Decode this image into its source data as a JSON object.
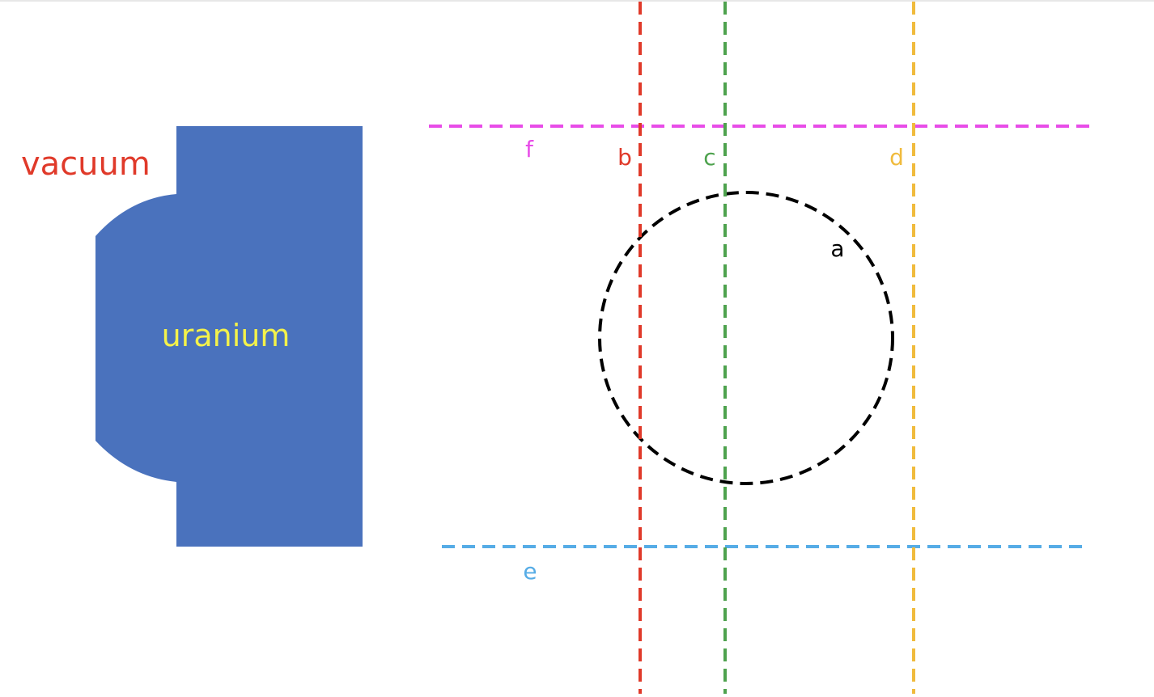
{
  "labels": {
    "vacuum": "vacuum",
    "uranium": "uranium",
    "a": "a",
    "b": "b",
    "c": "c",
    "d": "d",
    "e": "e",
    "f": "f"
  },
  "colors": {
    "background": "#ffffff",
    "uranium_fill": "#4a72bd",
    "uranium_text": "#f4f24a",
    "vacuum_text": "#e03a2a",
    "line_a": "#000000",
    "line_b": "#e03a2a",
    "line_c": "#4ea24e",
    "line_d": "#f0bb3d",
    "line_e": "#56ace6",
    "line_f": "#e84ce8"
  }
}
